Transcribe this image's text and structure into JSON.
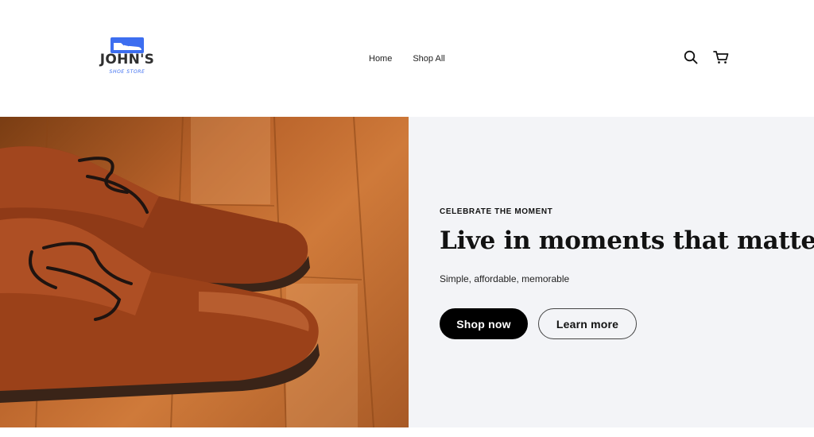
{
  "brand": {
    "name": "JOHN'S",
    "tagline": "SHOE STORE",
    "accent_color": "#3d6ef0"
  },
  "nav": {
    "items": [
      {
        "label": "Home"
      },
      {
        "label": "Shop All"
      }
    ]
  },
  "header_icons": {
    "search": "search-icon",
    "cart": "cart-icon"
  },
  "hero": {
    "image_alt": "brown-leather-shoes-on-wooden-floor",
    "eyebrow": "CELEBRATE THE MOMENT",
    "headline": "Live in moments that matter",
    "subtext": "Simple, affordable, memorable",
    "primary_button": "Shop now",
    "secondary_button": "Learn more",
    "panel_color": "#f3f4f7"
  }
}
